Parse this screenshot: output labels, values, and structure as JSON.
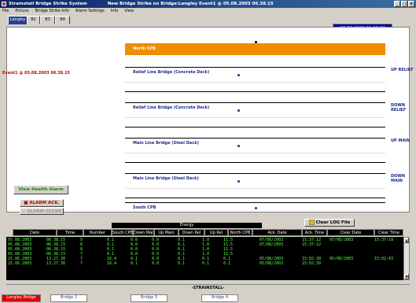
{
  "window": {
    "app_title": "Strainstall Bridge Strike System",
    "subtitle": "New Bridge Strike on Bridge:Langley Event1 @ 05.08.2003   06.38.15",
    "minimize": "_",
    "maximize": "□",
    "close": "x"
  },
  "menu": [
    "File",
    "Picture",
    "Bridge Strike Info",
    "Alarm Settings",
    "Info",
    "View"
  ],
  "tabs": [
    "Langley",
    "B2",
    "B3",
    "B4"
  ],
  "datetime": "07.08.2003   15.29.32",
  "event_label": "Event1 @ 05.08.2003    06.38.15",
  "bands": [
    {
      "name": "North CPB",
      "side": ""
    },
    {
      "name": "Relief Line Bridge (Concrete Deck)",
      "side": "UP RELIEF"
    },
    {
      "name": "Relief Line Bridge (Concrete Deck)",
      "side": "DOWN RELIEF"
    },
    {
      "name": "Main Line Bridge (Steel Deck)",
      "side": "UP MAIN"
    },
    {
      "name": "Main Line Bridge (Steel Deck)",
      "side": "DOWN MAIN"
    },
    {
      "name": "South CPB",
      "side": ""
    }
  ],
  "buttons": {
    "view_health": "View Health Alarm",
    "alarm_ack": "ALARM ACK.",
    "alarm_clear": "ALARM CLEAR",
    "clear_log": "Clear LOG File"
  },
  "table": {
    "energy_header": "Energy",
    "columns": [
      "Date",
      "Time",
      "Number",
      "South CPB",
      "Down Main",
      "Up Main",
      "Down Rel",
      "Up Rel",
      "North CPB",
      "Ack. Date",
      "Ack. Time",
      "Clear Date",
      "Clear Time"
    ],
    "rows": [
      [
        "05.08.2003",
        "06.38.15",
        "9",
        "0.1",
        "0.0",
        "0.0",
        "0.1",
        "1.0",
        "11.5",
        "07/08/2003",
        "15:37:12",
        "07/08/2003",
        "15:37:18"
      ],
      [
        "05.08.2003",
        "06.38.15",
        "8",
        "0.1",
        "0.0",
        "0.0",
        "0.1",
        "1.0",
        "11.5",
        "07/08/2003",
        "15:37:12",
        "",
        ""
      ],
      [
        "05.08.2003",
        "06.38.15",
        "8",
        "0.1",
        "0.0",
        "0.0",
        "0.1",
        "1.0",
        "11.5",
        "",
        "",
        "",
        ""
      ],
      [
        "05.08.2003",
        "06.38.15",
        "7",
        "0.1",
        "0.0",
        "0.0",
        "0.1",
        "1.0",
        "11.5",
        "",
        "",
        "",
        ""
      ],
      [
        "25.06.2003",
        "13.27.36",
        "7",
        "16.4",
        "0.1",
        "0.0",
        "0.1",
        "0.1",
        "0.1",
        "05/08/2003",
        "15:02:30",
        "05/08/2003",
        "15:02:43"
      ],
      [
        "25.06.2003",
        "13.27.36",
        "7",
        "16.4",
        "0.1",
        "0.0",
        "0.1",
        "0.1",
        "0.1",
        "05/08/2003",
        "15:02:30",
        "",
        ""
      ]
    ]
  },
  "footer": "-STRAINSTALL-",
  "status_tabs": [
    "Langley Bridge",
    "Bridge 2",
    "Bridge 3",
    "Bridge 4"
  ]
}
